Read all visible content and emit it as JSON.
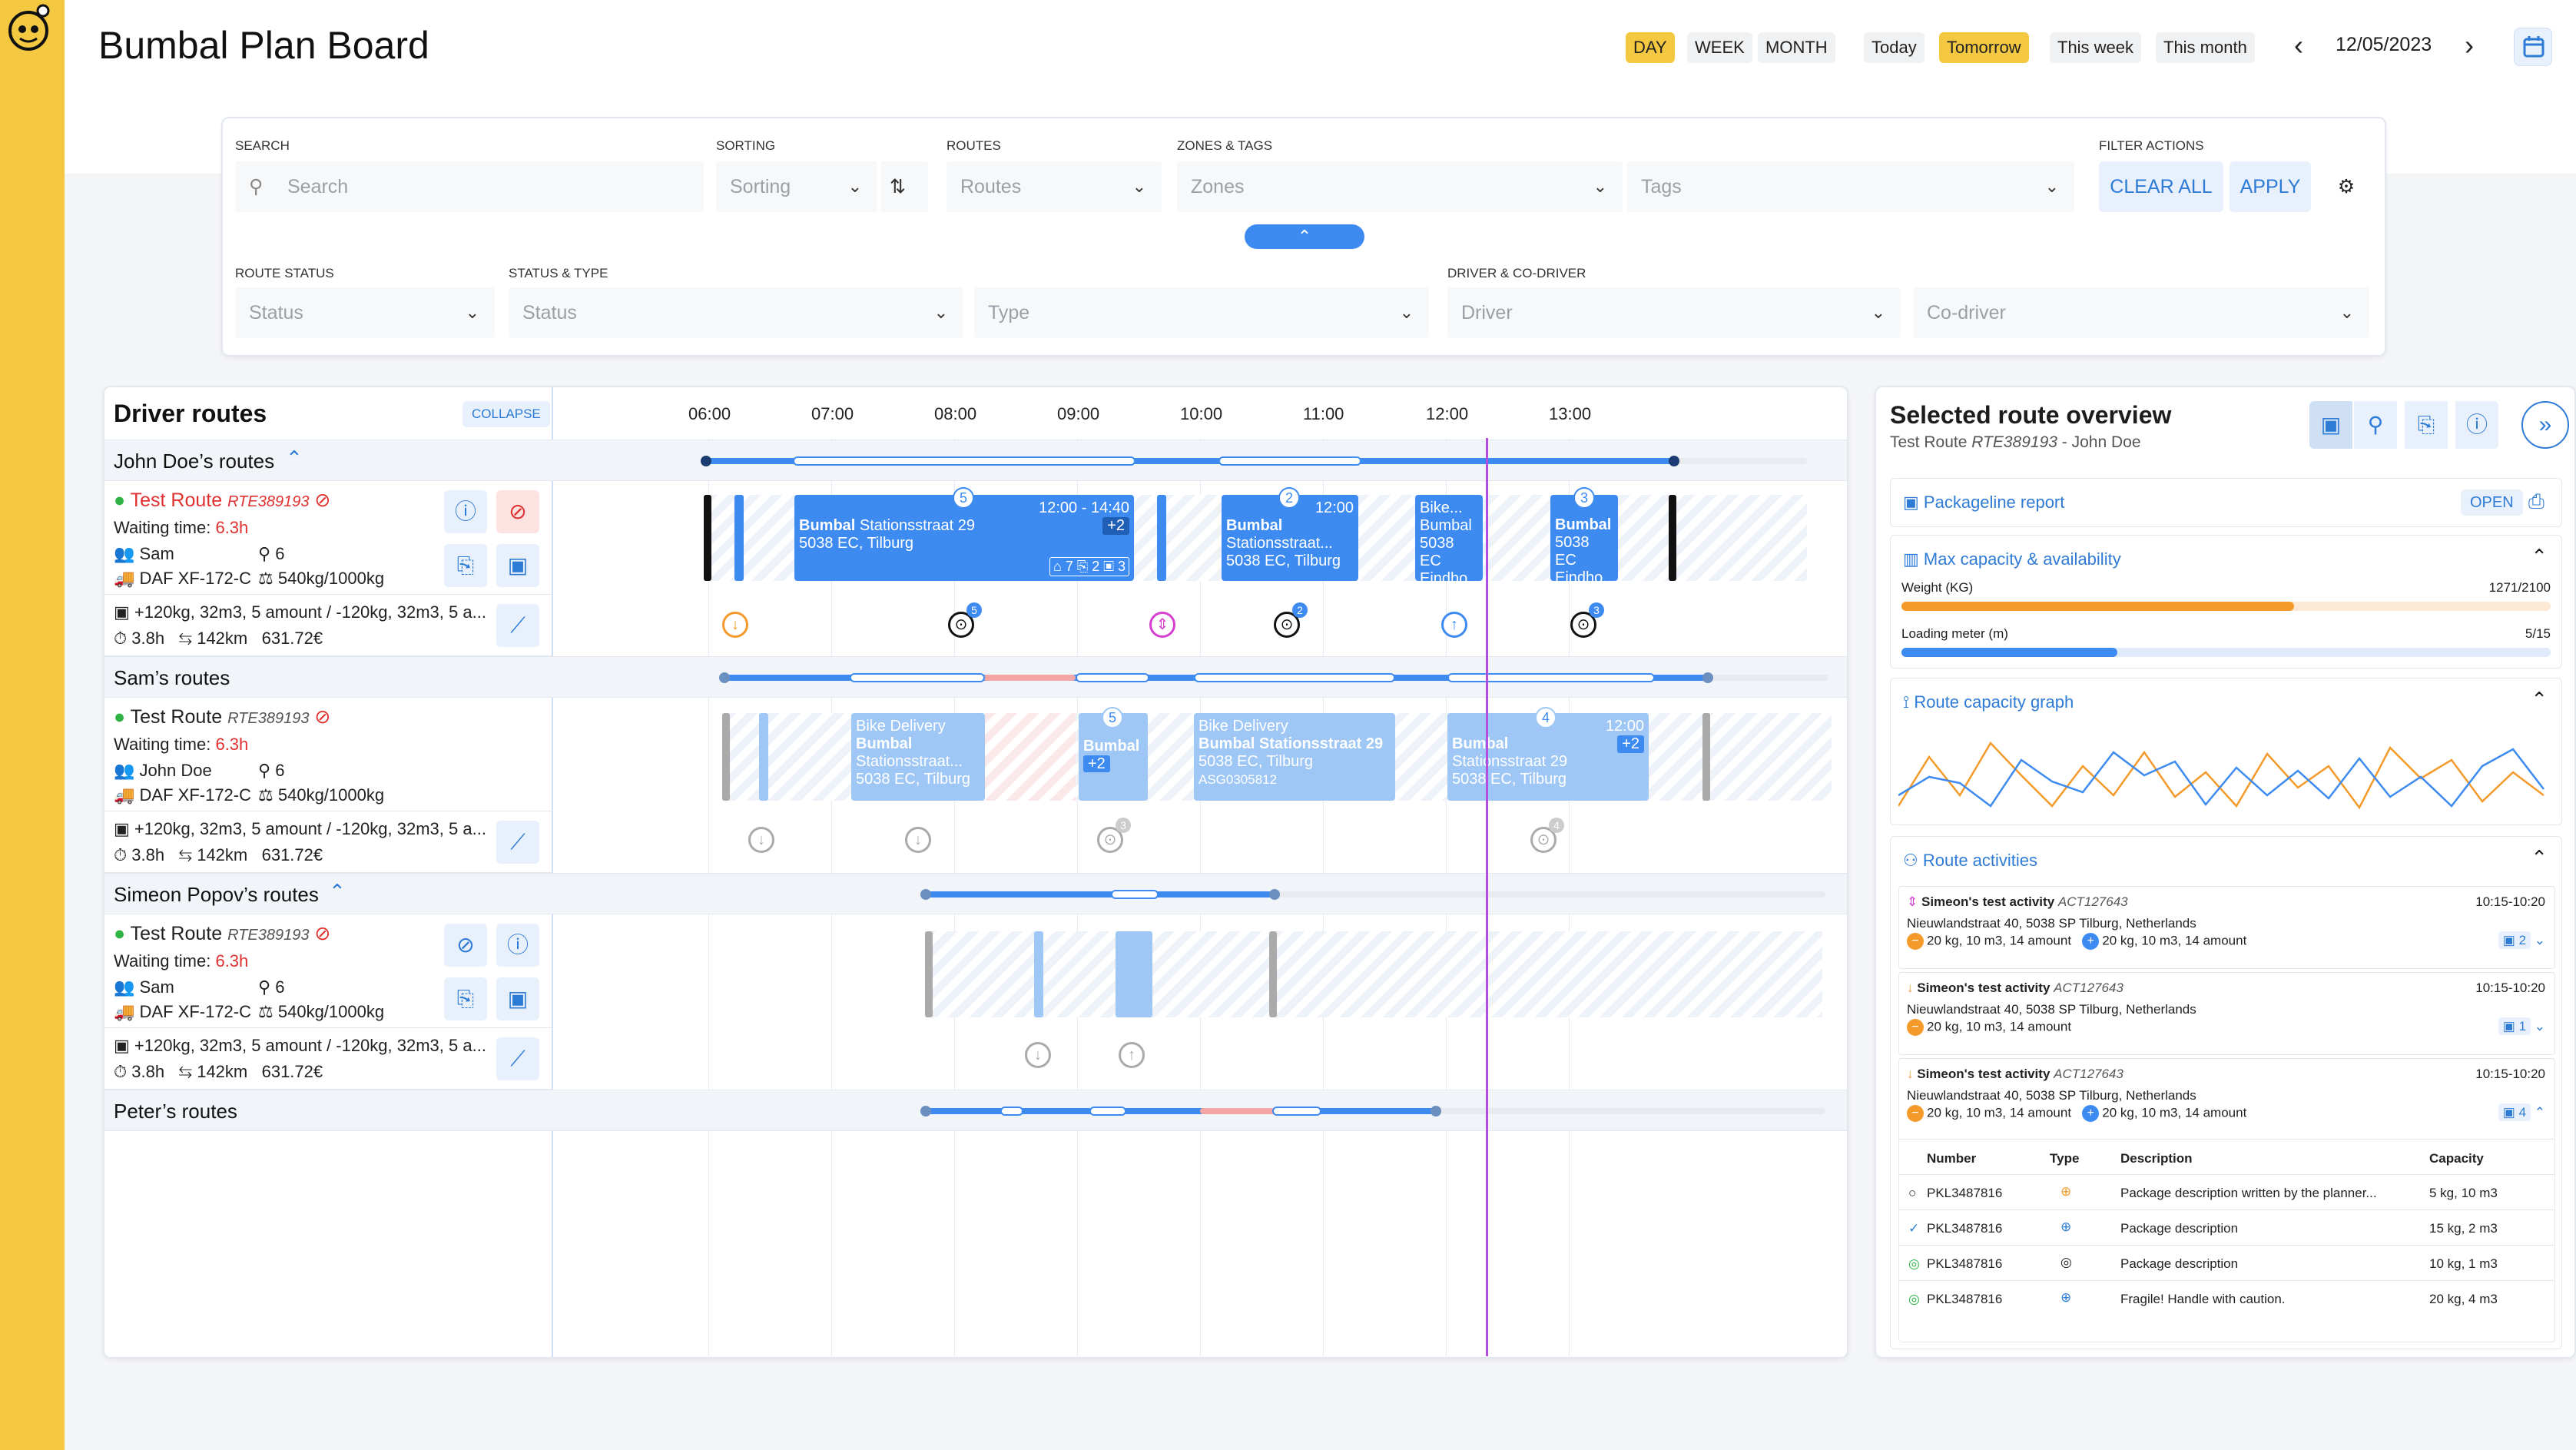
{
  "app": {
    "title": "Bumbal Plan Board"
  },
  "header": {
    "range_tabs": [
      "DAY",
      "WEEK",
      "MONTH"
    ],
    "quick_tabs": [
      "Today",
      "Tomorrow",
      "This week",
      "This month"
    ],
    "date": "12/05/2023"
  },
  "filters": {
    "search": {
      "label": "SEARCH",
      "placeholder": "Search"
    },
    "sorting": {
      "label": "SORTING",
      "placeholder": "Sorting"
    },
    "routes": {
      "label": "ROUTES",
      "placeholder": "Routes"
    },
    "zones_tags": {
      "label": "ZONES & TAGS",
      "zones_placeholder": "Zones",
      "tags_placeholder": "Tags"
    },
    "actions": {
      "label": "FILTER ACTIONS",
      "clear": "CLEAR ALL",
      "apply": "APPLY"
    },
    "route_status": {
      "label": "ROUTE STATUS",
      "placeholder": "Status"
    },
    "status_type": {
      "label": "STATUS & TYPE",
      "status_placeholder": "Status",
      "type_placeholder": "Type"
    },
    "driver": {
      "label": "DRIVER & CO-DRIVER",
      "driver_placeholder": "Driver",
      "codriver_placeholder": "Co-driver"
    }
  },
  "board": {
    "title": "Driver routes",
    "collapse": "COLLAPSE",
    "hours": [
      "06:00",
      "07:00",
      "08:00",
      "09:00",
      "10:00",
      "11:00",
      "12:00",
      "13:00"
    ],
    "groups": [
      {
        "name": "John Doe’s routes"
      },
      {
        "name": "Sam’s routes"
      },
      {
        "name": "Simeon Popov’s routes"
      },
      {
        "name": "Peter’s routes"
      }
    ],
    "routes": [
      {
        "name": "Test Route",
        "code": "RTE389193",
        "waiting_label": "Waiting time:",
        "waiting": "6.3h",
        "person": "Sam",
        "seats": "6",
        "vehicle": "DAF XF-172-C",
        "cap": "540kg/1000kg",
        "load": "+120kg, 32m3, 5 amount / -120kg, 32m3, 5 a...",
        "time": "3.8h",
        "dist": "142km",
        "cost": "631.72€"
      },
      {
        "name": "Test Route",
        "code": "RTE389193",
        "waiting_label": "Waiting time:",
        "waiting": "6.3h",
        "person": "John Doe",
        "seats": "6",
        "vehicle": "DAF XF-172-C",
        "cap": "540kg/1000kg",
        "load": "+120kg, 32m3, 5 amount / -120kg, 32m3, 5 a...",
        "time": "3.8h",
        "dist": "142km",
        "cost": "631.72€"
      },
      {
        "name": "Test Route",
        "code": "RTE389193",
        "waiting_label": "Waiting time:",
        "waiting": "6.3h",
        "person": "Sam",
        "seats": "6",
        "vehicle": "DAF XF-172-C",
        "cap": "540kg/1000kg",
        "load": "+120kg, 32m3, 5 amount / -120kg, 32m3, 5 a...",
        "time": "3.8h",
        "dist": "142km",
        "cost": "631.72€"
      }
    ],
    "stops": {
      "r1a": {
        "badge": "5",
        "time": "12:00 - 14:40",
        "name": "Bumbal",
        "addr1": "Stationsstraat 29",
        "addr2": "5038 EC, Tilburg",
        "more": "+2",
        "tags": "7",
        "files": "2",
        "pkgs": "3"
      },
      "r1b": {
        "badge": "2",
        "time": "12:00",
        "name": "Bumbal",
        "addr1": "Stationsstraat...",
        "addr2": "5038 EC, Tilburg"
      },
      "r1c": {
        "l1": "Bike...",
        "l2": "Bumbal",
        "l3": "5038 EC",
        "l4": "Eindho..."
      },
      "r1d": {
        "badge": "3",
        "l1": "Bumbal",
        "l2": "5038 EC",
        "l3": "Eindho..."
      },
      "r2a": {
        "l1": "Bike Delivery",
        "l2": "Bumbal",
        "l3": "Stationsstraat...",
        "l4": "5038 EC, Tilburg"
      },
      "r2b": {
        "badge": "5",
        "l1": "Bumbal",
        "l2": "+2"
      },
      "r2c": {
        "l1": "Bike Delivery",
        "l2": "Bumbal Stationsstraat 29",
        "l3": "5038 EC, Tilburg",
        "l4": "ASG0305812"
      },
      "r2d": {
        "badge": "4",
        "time": "12:00",
        "l1": "Bumbal",
        "l2": "Stationsstraat 29",
        "l3": "5038 EC, Tilburg",
        "more": "+2"
      }
    },
    "markers": {
      "r1": [
        "5",
        "2",
        "3"
      ],
      "r2": [
        "3",
        "4"
      ]
    }
  },
  "overview": {
    "title": "Selected route overview",
    "subtitle_route": "Test Route",
    "subtitle_code": "RTE389193",
    "subtitle_driver": "- John Doe",
    "packageline": {
      "title": "Packageline report",
      "open": "OPEN"
    },
    "capacity": {
      "title": "Max capacity & availability",
      "weight_label": "Weight (KG)",
      "weight_value": "1271/2100",
      "weight_fraction": 0.605,
      "meter_label": "Loading meter (m)",
      "meter_value": "5/15",
      "meter_fraction": 0.333
    },
    "graph": {
      "title": "Route capacity graph"
    },
    "activities": {
      "title": "Route activities",
      "items": [
        {
          "name": "Simeon's test activity",
          "code": "ACT127643",
          "time": "10:15-10:20",
          "address": "Nieuwlandstraat 40, 5038 SP Tilburg, Netherlands",
          "minus": "20 kg, 10 m3, 14 amount",
          "plus": "20 kg, 10 m3, 14 amount",
          "count": "2"
        },
        {
          "name": "Simeon's test activity",
          "code": "ACT127643",
          "time": "10:15-10:20",
          "address": "Nieuwlandstraat 40, 5038 SP Tilburg, Netherlands",
          "minus": "20 kg, 10 m3, 14 amount",
          "count": "1"
        },
        {
          "name": "Simeon's test activity",
          "code": "ACT127643",
          "time": "10:15-10:20",
          "address": "Nieuwlandstraat 40, 5038 SP Tilburg, Netherlands",
          "minus": "20 kg, 10 m3, 14 amount",
          "plus": "20 kg, 10 m3, 14 amount",
          "count": "4"
        }
      ],
      "table": {
        "headers": [
          "Number",
          "Type",
          "Description",
          "Capacity"
        ],
        "rows": [
          {
            "number": "PKL3487816",
            "desc": "Package description written by the planner...",
            "cap": "5 kg, 10 m3"
          },
          {
            "number": "PKL3487816",
            "desc": "Package description",
            "cap": "15 kg, 2 m3"
          },
          {
            "number": "PKL3487816",
            "desc": "Package description",
            "cap": "10 kg, 1 m3"
          },
          {
            "number": "PKL3487816",
            "desc": "Fragile! Handle with caution.",
            "cap": "20 kg, 4 m3"
          }
        ]
      }
    }
  },
  "colors": {
    "brand": "#f5c842",
    "accent": "#3d8bf0",
    "danger": "#e03131",
    "now_line": "#b44ee0"
  }
}
